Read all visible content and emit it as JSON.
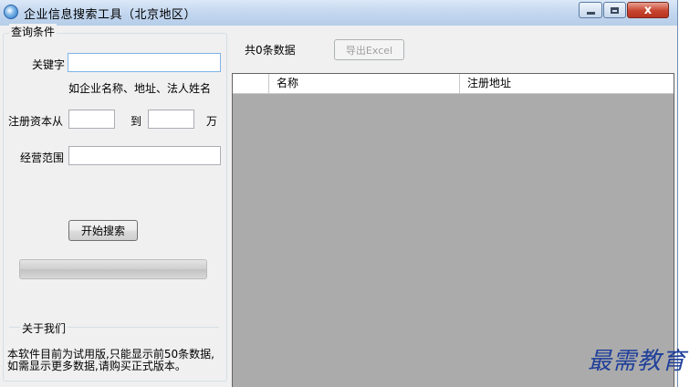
{
  "window": {
    "title": "企业信息搜索工具（北京地区）",
    "close_glyph": "x"
  },
  "query": {
    "group_title": "查询条件",
    "keyword_label": "关键字",
    "keyword_value": "",
    "keyword_hint": "如企业名称、地址、法人姓名",
    "capital_from_label": "注册资本从",
    "capital_from_value": "",
    "capital_to_label": "到",
    "capital_to_value": "",
    "capital_unit": "万",
    "scope_label": "经营范围",
    "scope_value": "",
    "search_button": "开始搜索",
    "progress": 0
  },
  "about": {
    "title": "关于我们",
    "text": "本软件目前为试用版,只能显示前50条数据,如需显示更多数据,请购买正式版本。"
  },
  "results": {
    "count_text": "共0条数据",
    "export_button": "导出Excel",
    "columns": [
      "名称",
      "注册地址"
    ]
  },
  "watermark": "最需教育",
  "colors": {
    "grid_background": "#ababab",
    "close_button": "#c7452f",
    "watermark": "#1f3f9a"
  }
}
